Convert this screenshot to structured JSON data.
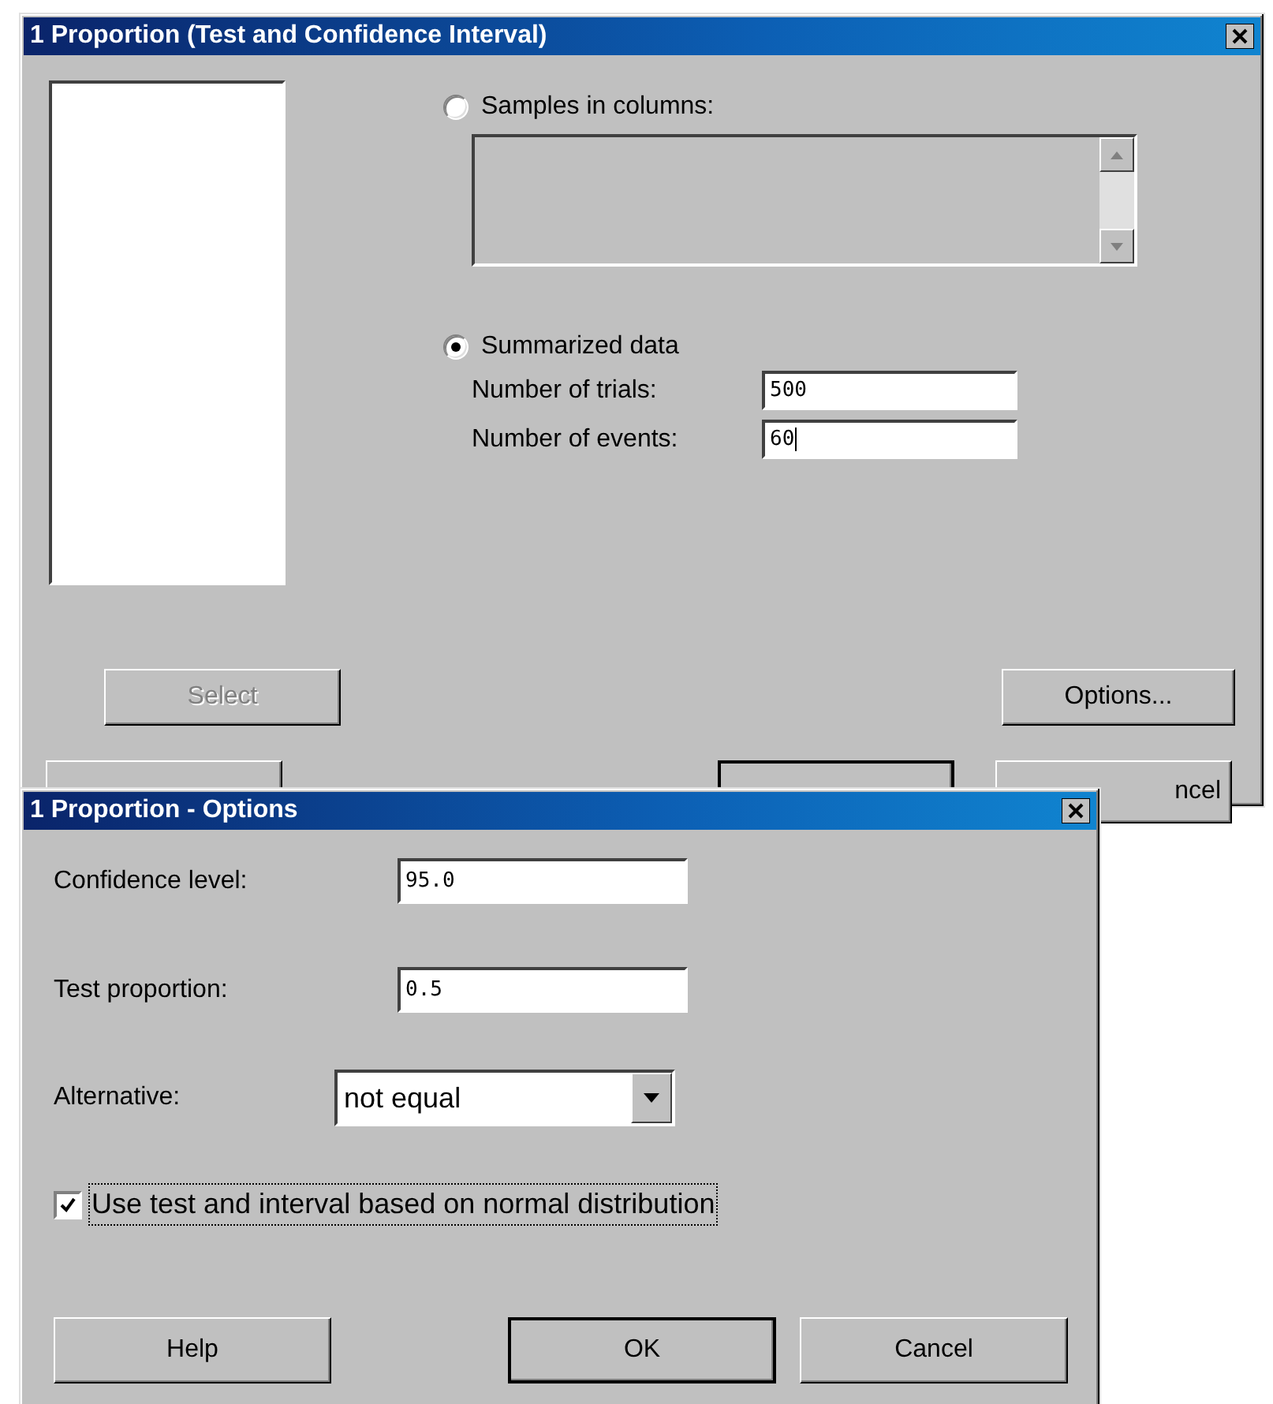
{
  "main_window": {
    "title": "1 Proportion (Test and Confidence Interval)",
    "data_source": [
      {
        "label": "Samples in columns:",
        "selected": false
      },
      {
        "label": "Summarized data",
        "selected": true
      }
    ],
    "columns_list": {
      "disabled": true
    },
    "fields": [
      {
        "label": "Number of trials:",
        "value": "500",
        "focused": false
      },
      {
        "label": "Number of events:",
        "value": "60",
        "focused": true
      }
    ],
    "buttons": [
      {
        "label": "Select",
        "disabled": true
      },
      {
        "label": "Options...",
        "disabled": false
      }
    ],
    "bottom_buttons": [
      {
        "kind": "plain"
      },
      {
        "kind": "default"
      },
      {
        "kind": "plain",
        "label": "ncel"
      }
    ]
  },
  "options_dialog": {
    "title": "1 Proportion - Options",
    "fields": [
      {
        "label": "Confidence level:",
        "value": "95.0"
      },
      {
        "label": "Test proportion:",
        "value": "0.5"
      }
    ],
    "alternative": {
      "label": "Alternative:",
      "value": "not equal"
    },
    "normal_checkbox": {
      "label": "Use test and interval based on normal distribution",
      "checked": true,
      "focused": true
    },
    "buttons": [
      {
        "label": "Help",
        "default": false
      },
      {
        "label": "OK",
        "default": true
      },
      {
        "label": "Cancel",
        "default": false
      }
    ]
  }
}
